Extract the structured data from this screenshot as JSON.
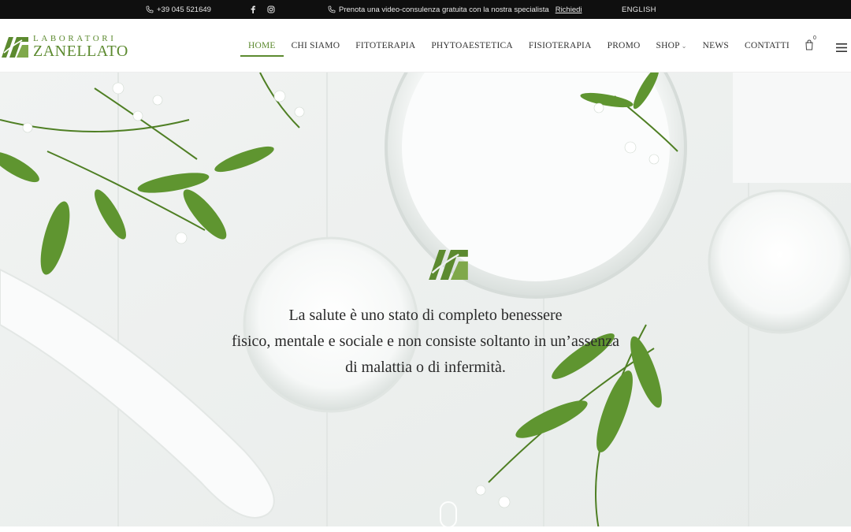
{
  "topbar": {
    "phone": "+39 045 521649",
    "promo_text": "Prenota una video-consulenza gratuita con la nostra specialista",
    "promo_link": "Richiedi",
    "language": "ENGLISH",
    "social": [
      "facebook-icon",
      "instagram-icon"
    ]
  },
  "logo": {
    "line1": "LABORATORI",
    "line2": "ZANELLATO"
  },
  "nav": {
    "items": [
      {
        "label": "HOME"
      },
      {
        "label": "CHI SIAMO"
      },
      {
        "label": "FITOTERAPIA"
      },
      {
        "label": "PHYTOAESTETICA"
      },
      {
        "label": "FISIOTERAPIA"
      },
      {
        "label": "PROMO"
      },
      {
        "label": "SHOP"
      },
      {
        "label": "NEWS"
      },
      {
        "label": "CONTATTI"
      }
    ],
    "active_index": 0
  },
  "cart": {
    "count": "0"
  },
  "hero": {
    "line1": "La salute è uno stato di completo benessere",
    "line2": "fisico, mentale e sociale e non consiste soltanto in un’assenza",
    "line3": "di malattia o di infermità."
  },
  "colors": {
    "brand_green": "#5c8a2f",
    "topbar_bg": "#0f0f0f"
  }
}
